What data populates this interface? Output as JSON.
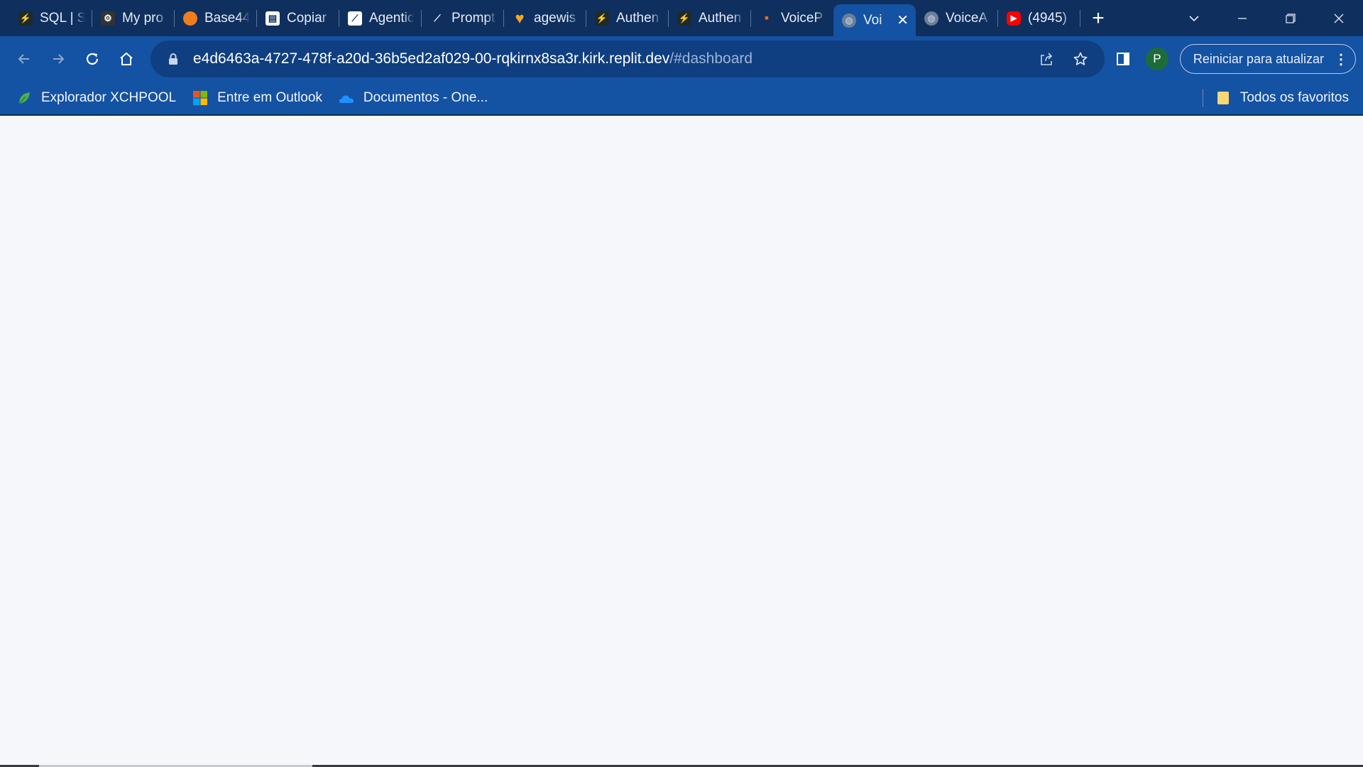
{
  "tabs": [
    {
      "title": "SQL | S",
      "icon": "replit-icon",
      "color": "#1f2b2a"
    },
    {
      "title": "My pro",
      "icon": "gear-icon",
      "color": "#333333"
    },
    {
      "title": "Base44",
      "icon": "base44-icon",
      "color": "#f07c1e"
    },
    {
      "title": "Copiar",
      "icon": "document-icon",
      "color": "#ffffff"
    },
    {
      "title": "Agentic",
      "icon": "agentic-icon",
      "color": "#ffffff"
    },
    {
      "title": "Prompt",
      "icon": "prompt-icon",
      "color": "#0f2f5e"
    },
    {
      "title": "agewis",
      "icon": "heart-icon",
      "color": "#f5a623"
    },
    {
      "title": "Authen",
      "icon": "bolt-icon",
      "color": "#1f2b2a"
    },
    {
      "title": "Authen",
      "icon": "bolt-icon",
      "color": "#1f2b2a"
    },
    {
      "title": "VoiceP",
      "icon": "grid-icon",
      "color": "#f26b1d"
    },
    {
      "title": "Voi",
      "icon": "globe-icon",
      "color": "#6b7f99",
      "active": true
    },
    {
      "title": "VoiceA",
      "icon": "globe-icon",
      "color": "#6b7f99"
    },
    {
      "title": "(4945)",
      "icon": "youtube-icon",
      "color": "#ff0000"
    }
  ],
  "address": {
    "host": "e4d6463a-4727-478f-a20d-36b5ed2af029-00-rqkirnx8sa3r.kirk.replit.dev",
    "path": "/#dashboard"
  },
  "profile": {
    "initial": "P"
  },
  "restart_label": "Reiniciar para atualizar",
  "bookmarks": [
    {
      "label": "Explorador XCHPOOL",
      "icon": "leaf-icon"
    },
    {
      "label": "Entre em Outlook",
      "icon": "microsoft-icon"
    },
    {
      "label": "Documentos - One...",
      "icon": "onedrive-icon"
    }
  ],
  "all_bookmarks_label": "Todos os favoritos"
}
